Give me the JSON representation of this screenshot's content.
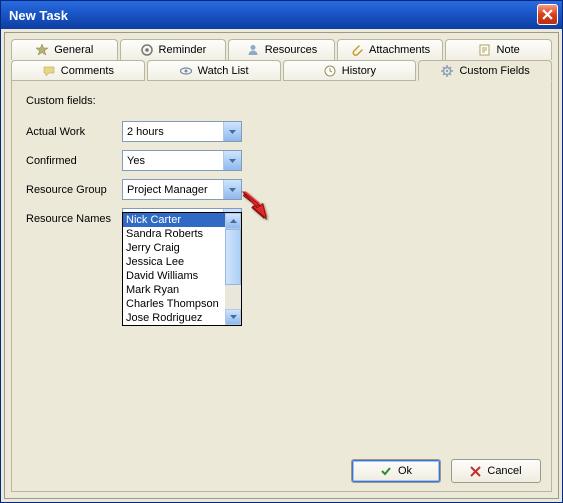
{
  "window": {
    "title": "New Task"
  },
  "tabs_row1": [
    {
      "label": "General",
      "icon": "star-icon"
    },
    {
      "label": "Reminder",
      "icon": "target-icon"
    },
    {
      "label": "Resources",
      "icon": "person-icon"
    },
    {
      "label": "Attachments",
      "icon": "paperclip-icon"
    },
    {
      "label": "Note",
      "icon": "note-icon"
    }
  ],
  "tabs_row2": [
    {
      "label": "Comments",
      "icon": "chat-icon"
    },
    {
      "label": "Watch List",
      "icon": "eye-icon"
    },
    {
      "label": "History",
      "icon": "clock-icon"
    },
    {
      "label": "Custom Fields",
      "icon": "gear-icon",
      "active": true
    }
  ],
  "section_title": "Custom fields:",
  "fields": {
    "actual_work": {
      "label": "Actual Work",
      "value": "2 hours"
    },
    "confirmed": {
      "label": "Confirmed",
      "value": "Yes"
    },
    "resource_group": {
      "label": "Resource Group",
      "value": "Project Manager"
    },
    "resource_names": {
      "label": "Resource Names",
      "value": "Nick Carter"
    }
  },
  "dropdown": {
    "items": [
      "Nick Carter",
      "Sandra Roberts",
      "Jerry Craig",
      "Jessica Lee",
      "David Williams",
      "Mark Ryan",
      "Charles Thompson",
      "Jose Rodriguez"
    ],
    "selected_index": 0
  },
  "buttons": {
    "ok": "Ok",
    "cancel": "Cancel"
  },
  "colors": {
    "titlebar": "#1956c6",
    "accent": "#316ac5"
  }
}
